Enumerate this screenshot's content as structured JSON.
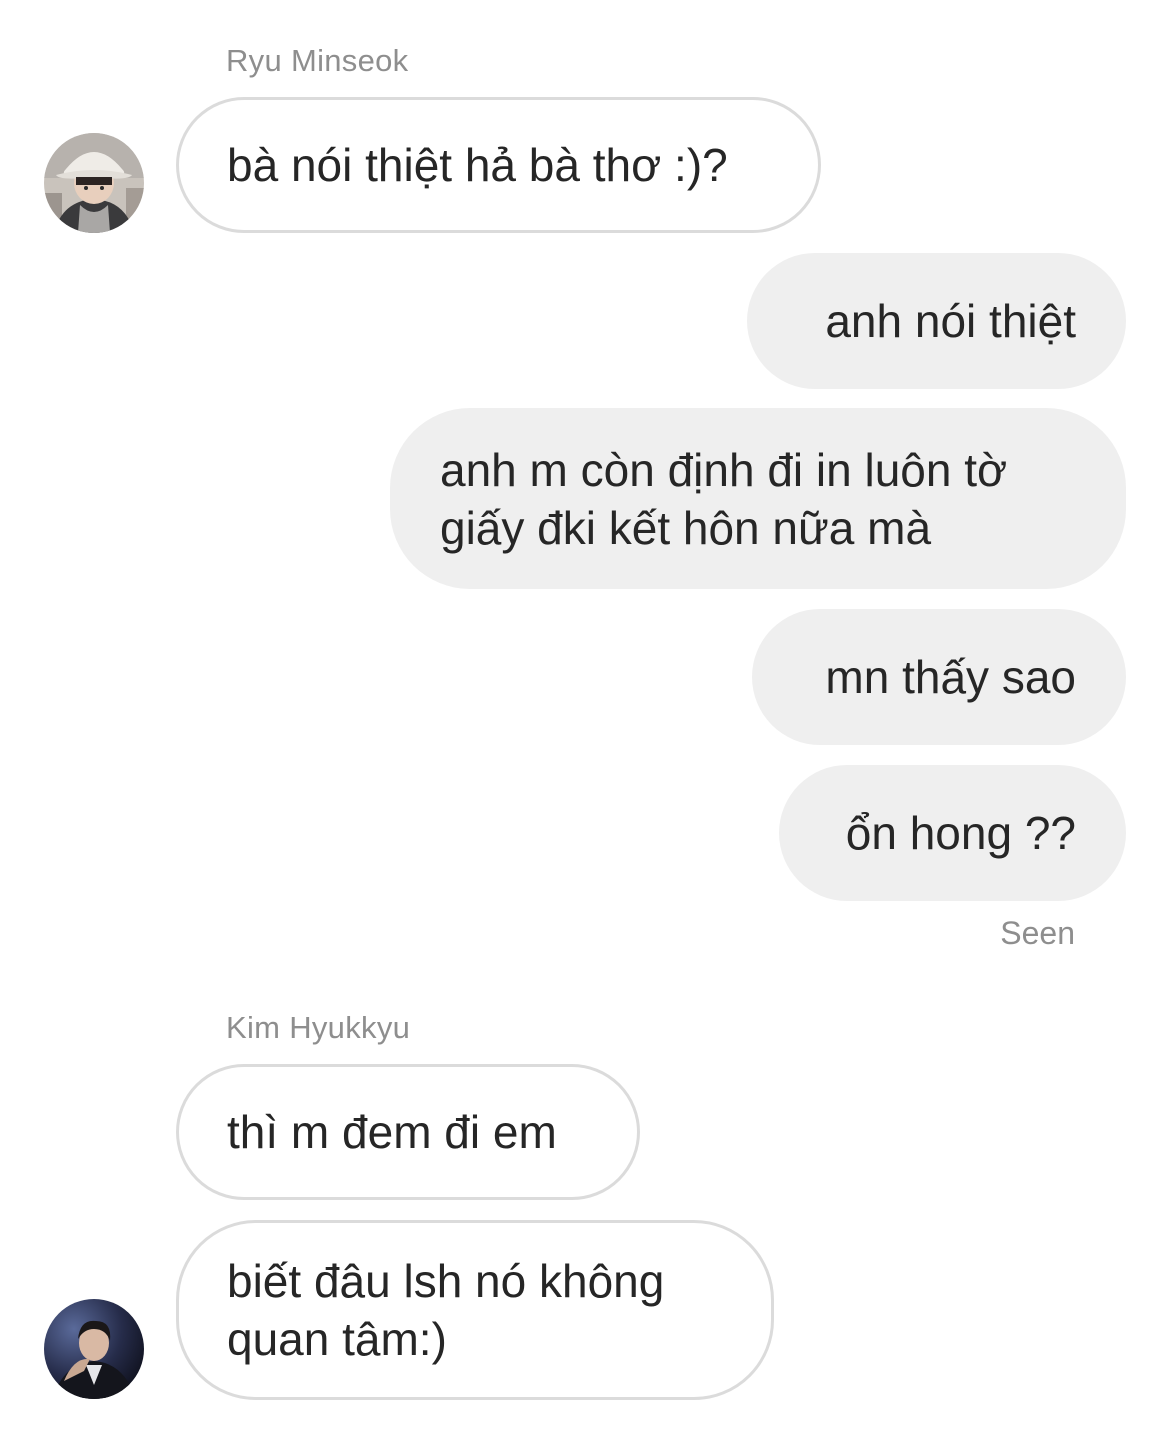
{
  "thread": {
    "group1": {
      "sender": "Ryu Minseok",
      "messages": [
        "bà nói thiệt hả bà thơ :)?"
      ]
    },
    "outgoing": {
      "messages": [
        "anh nói thiệt",
        "anh m còn định đi in luôn tờ\ngiấy đki kết hôn nữa mà",
        "mn thấy sao",
        "ổn hong ??"
      ],
      "status": "Seen"
    },
    "group2": {
      "sender": "Kim Hyukkyu",
      "messages": [
        "thì m đem đi em",
        "biết đâu lsh nó không\nquan tâm:)"
      ]
    }
  },
  "colors": {
    "incoming_border": "#dbdbdb",
    "outgoing_bg": "#efefef",
    "meta_text": "#8e8e8e",
    "message_text": "#262626"
  },
  "icons": {
    "avatar1": "user-photo-bucket-hat",
    "avatar2": "user-photo-dark-suit"
  }
}
